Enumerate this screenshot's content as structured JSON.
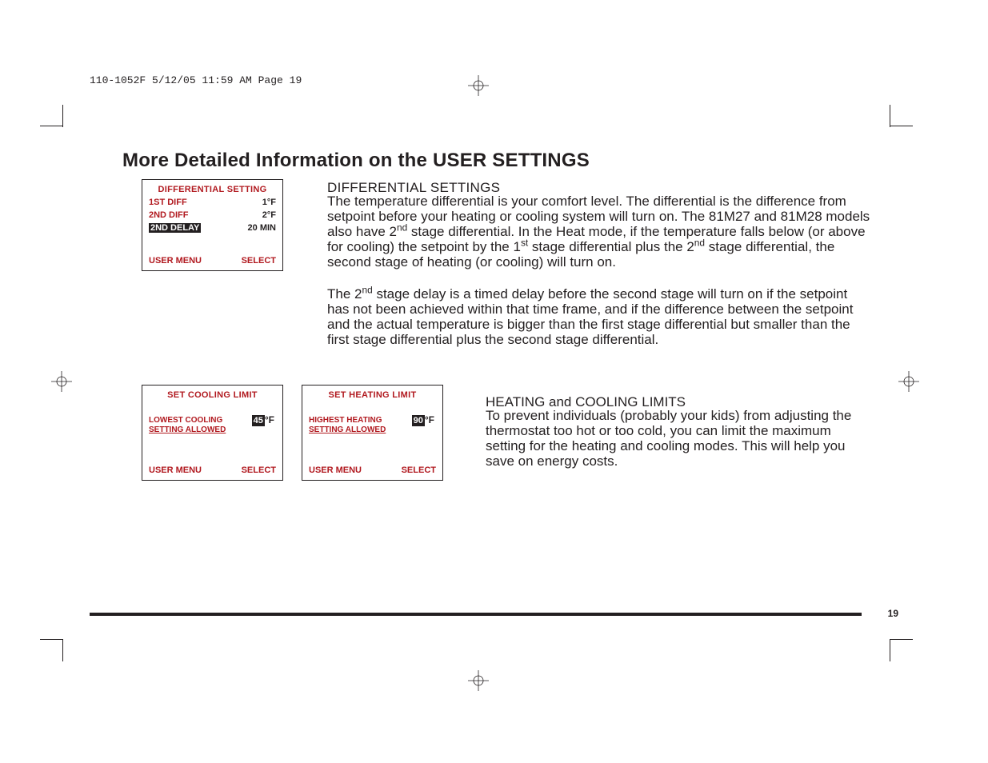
{
  "slug": "110-1052F  5/12/05  11:59 AM  Page 19",
  "page_number": "19",
  "headline": "More Detailed Information on the USER SETTINGS",
  "box1": {
    "title": "DIFFERENTIAL SETTING",
    "rows": [
      {
        "label": "1ST DIFF",
        "value": "1°F"
      },
      {
        "label": "2ND DIFF",
        "value": "2°F"
      },
      {
        "label": "2ND DELAY",
        "value": "20 MIN",
        "inverted": true
      }
    ],
    "menu": "USER MENU",
    "select": "SELECT"
  },
  "box2": {
    "title": "SET COOLING LIMIT",
    "label_line1": "LOWEST COOLING",
    "label_line2": "SETTING ALLOWED",
    "value_num": "45",
    "value_unit": "°F",
    "menu": "USER MENU",
    "select": "SELECT"
  },
  "box3": {
    "title": "SET HEATING LIMIT",
    "label_line1": "HIGHEST HEATING",
    "label_line2": "SETTING ALLOWED",
    "value_num": "90",
    "value_unit": "°F",
    "menu": "USER MENU",
    "select": "SELECT"
  },
  "section1": {
    "heading": "DIFFERENTIAL SETTINGS",
    "p1_a": "The temperature differential is your comfort level. The differential is the difference from setpoint before your heating or cooling system will turn on. The 81M27 and 81M28 models also have 2",
    "p1_b": " stage differential. In the Heat mode, if the temperature falls below (or above for cooling) the setpoint by the 1",
    "p1_c": " stage differential plus the 2",
    "p1_d": " stage differential, the second stage of heating (or cooling) will turn on.",
    "p2_a": "The 2",
    "p2_b": " stage delay is a timed delay before the second stage will turn on if the setpoint has not been achieved within that time frame, and if the difference between the setpoint and the actual temperature is bigger than the first stage differential but smaller than the first stage differential plus the second stage differential.",
    "sup_nd": "nd",
    "sup_st": "st"
  },
  "section2": {
    "heading": "HEATING and COOLING LIMITS",
    "p": "To prevent individuals (probably your kids) from adjusting the thermostat too hot or too cold, you can limit the maximum setting for the heating and cooling modes. This will help you save on energy costs."
  }
}
